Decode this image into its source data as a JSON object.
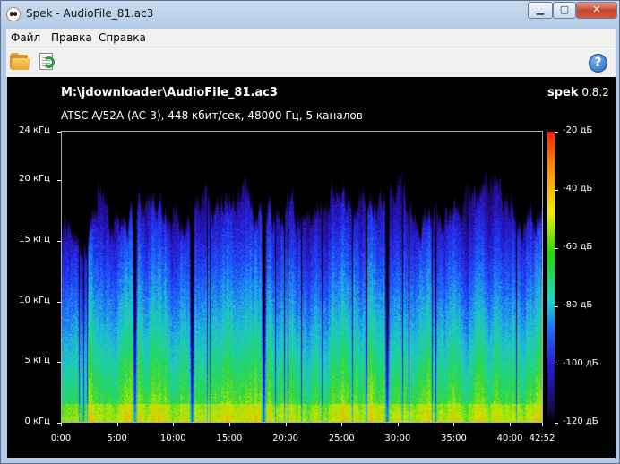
{
  "window": {
    "title": "Spek - AudioFile_81.ac3",
    "app_icon": "spek-face-icon",
    "controls": {
      "minimize": "▁",
      "maximize": "▢",
      "close": "✕"
    }
  },
  "menu": {
    "items": [
      "Файл",
      "Правка",
      "Справка"
    ]
  },
  "toolbar": {
    "open_icon": "folder-open-icon",
    "reload_icon": "reload-document-icon",
    "help_icon": "help-icon",
    "help_glyph": "?"
  },
  "spectrogram": {
    "file_path": "M:\\jdownloader\\AudioFile_81.ac3",
    "brand_name": "spek",
    "brand_version": "0.8.2",
    "file_info": "ATSC A/52A (AC-3), 448 кбит/сек, 48000 Гц, 5 каналов"
  },
  "chart_data": {
    "type": "heatmap",
    "title": "",
    "y_ticks": [
      "24 кГц",
      "20 кГц",
      "15 кГц",
      "10 кГц",
      "5 кГц",
      "0 кГц"
    ],
    "y_tick_values": [
      24,
      20,
      15,
      10,
      5,
      0
    ],
    "ylim": [
      0,
      24
    ],
    "x_ticks": [
      "0:00",
      "5:00",
      "10:00",
      "15:00",
      "20:00",
      "25:00",
      "30:00",
      "35:00",
      "40:00",
      "42:52"
    ],
    "x_tick_values": [
      0,
      5,
      10,
      15,
      20,
      25,
      30,
      35,
      40,
      42.867
    ],
    "xlim": [
      0,
      42.867
    ],
    "colorbar_ticks": [
      "-20 дБ",
      "-40 дБ",
      "-60 дБ",
      "-80 дБ",
      "-100 дБ",
      "-120 дБ"
    ],
    "colorbar_values": [
      -20,
      -40,
      -60,
      -80,
      -100,
      -120
    ],
    "colors": [
      "#ff1e00",
      "#ff8c00",
      "#f2ee00",
      "#21d900",
      "#1ad7c8",
      "#1d6bff",
      "#2a1bd6",
      "#150a52",
      "#000000"
    ],
    "silence_gaps_min": [
      6.5,
      11.6,
      18.0,
      29.0
    ],
    "cutoff_khz_typical": 18.5
  }
}
